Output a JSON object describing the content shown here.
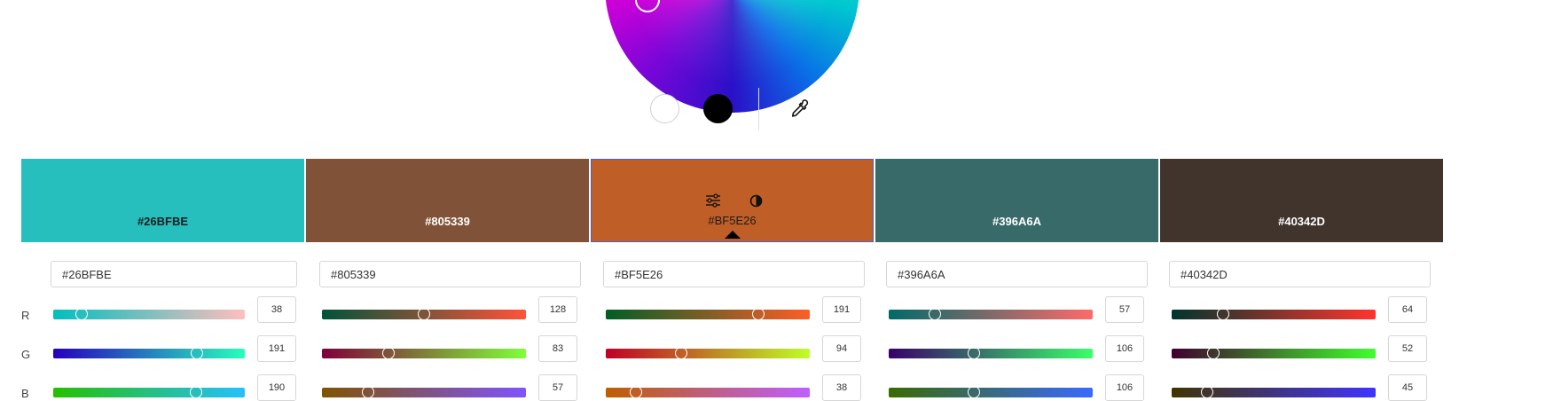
{
  "toolbar": {
    "white_icon": "white-circle-icon",
    "black_icon": "black-circle-icon",
    "eyedropper_icon": "eyedropper-icon"
  },
  "swatches": [
    {
      "hex": "#26BFBE",
      "color": "#26BFBE",
      "text_color": "#1d1d1d"
    },
    {
      "hex": "#805339",
      "color": "#805339",
      "text_color": "#ffffff"
    },
    {
      "hex": "#BF5E26",
      "color": "#BF5E26",
      "text_color": "#1d1d1d",
      "active": true
    },
    {
      "hex": "#396A6A",
      "color": "#396A6A",
      "text_color": "#ffffff"
    },
    {
      "hex": "#40342D",
      "color": "#40342D",
      "text_color": "#ffffff"
    }
  ],
  "row_labels": {
    "r": "R",
    "g": "G",
    "b": "B"
  },
  "editors": [
    {
      "hex_value": "#26BFBE",
      "r": "38",
      "g": "191",
      "b": "190"
    },
    {
      "hex_value": "#805339",
      "r": "128",
      "g": "83",
      "b": "57"
    },
    {
      "hex_value": "#BF5E26",
      "r": "191",
      "g": "94",
      "b": "38"
    },
    {
      "hex_value": "#396A6A",
      "r": "57",
      "g": "106",
      "b": "106"
    },
    {
      "hex_value": "#40342D",
      "r": "64",
      "g": "52",
      "b": "45"
    }
  ]
}
